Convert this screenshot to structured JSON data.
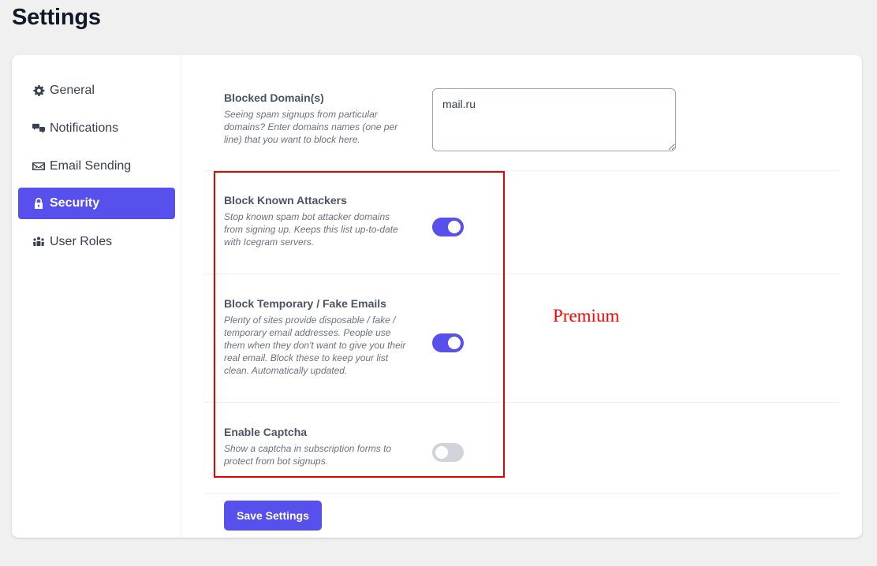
{
  "page": {
    "title": "Settings"
  },
  "sidebar": {
    "items": [
      {
        "label": "General",
        "icon": "gear-icon",
        "active": false
      },
      {
        "label": "Notifications",
        "icon": "chat-bubbles-icon",
        "active": false
      },
      {
        "label": "Email Sending",
        "icon": "envelope-icon",
        "active": false
      },
      {
        "label": "Security",
        "icon": "lock-icon",
        "active": true
      },
      {
        "label": "User Roles",
        "icon": "users-icon",
        "active": false
      }
    ]
  },
  "settings": {
    "blocked_domains": {
      "title": "Blocked Domain(s)",
      "description": "Seeing spam signups from particular domains? Enter domains names (one per line) that you want to block here.",
      "value": "mail.ru"
    },
    "block_known_attackers": {
      "title": "Block Known Attackers",
      "description": "Stop known spam bot attacker domains from signing up. Keeps this list up-to-date with Icegram servers.",
      "enabled": true
    },
    "block_temporary_emails": {
      "title": "Block Temporary / Fake Emails",
      "description": "Plenty of sites provide disposable / fake / temporary email addresses. People use them when they don't want to give you their real email. Block these to keep your list clean. Automatically updated.",
      "enabled": true
    },
    "enable_captcha": {
      "title": "Enable Captcha",
      "description": "Show a captcha in subscription forms to protect from bot signups.",
      "enabled": false
    }
  },
  "actions": {
    "save_label": "Save Settings"
  },
  "annotation": {
    "label": "Premium",
    "color": "#ff0000"
  },
  "colors": {
    "accent": "#5850ec",
    "toggle_off": "#d1d5db",
    "highlight": "#e60000"
  }
}
